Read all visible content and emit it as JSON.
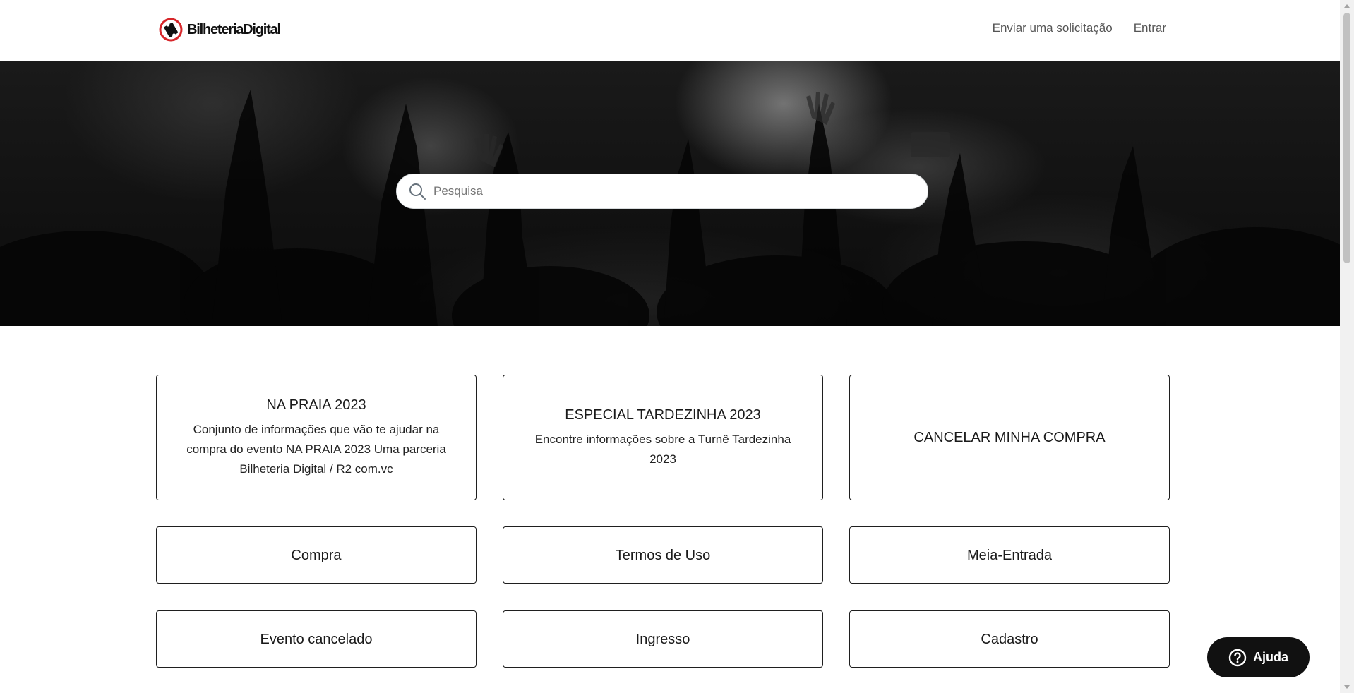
{
  "header": {
    "logo_text": "BilheteriaDigital",
    "nav": [
      {
        "label": "Enviar uma solicitação"
      },
      {
        "label": "Entrar"
      }
    ]
  },
  "hero": {
    "search_placeholder": "Pesquisa"
  },
  "categories": [
    {
      "title": "NA PRAIA 2023",
      "description": "Conjunto de informações que vão te ajudar na compra do evento NA PRAIA 2023 Uma parceria Bilheteria Digital / R2 com.vc"
    },
    {
      "title": "ESPECIAL TARDEZINHA 2023",
      "description": "Encontre informações sobre a Turnê Tardezinha 2023"
    },
    {
      "title": "CANCELAR MINHA COMPRA",
      "description": ""
    },
    {
      "title": "Compra",
      "description": ""
    },
    {
      "title": "Termos de Uso",
      "description": ""
    },
    {
      "title": "Meia-Entrada",
      "description": ""
    },
    {
      "title": "Evento cancelado",
      "description": ""
    },
    {
      "title": "Ingresso",
      "description": ""
    },
    {
      "title": "Cadastro",
      "description": ""
    }
  ],
  "help_widget": {
    "label": "Ajuda",
    "icon": "question-circle-icon"
  },
  "colors": {
    "brand_red": "#d7262a",
    "help_bg": "#111111"
  }
}
